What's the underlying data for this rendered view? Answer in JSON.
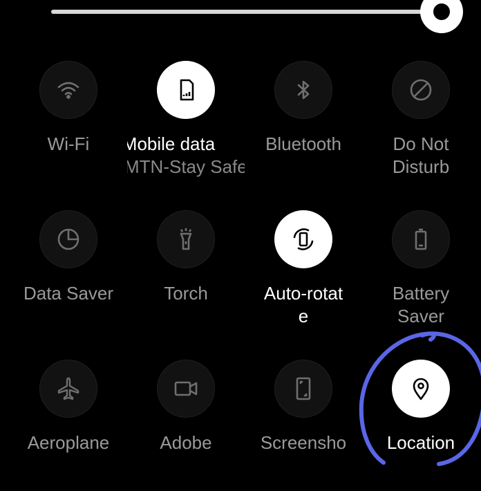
{
  "brightness": {
    "level": 0.95
  },
  "tiles": [
    {
      "label": "Wi-Fi",
      "icon": "wifi-icon",
      "on": false
    },
    {
      "label": "Mobile data",
      "sublabel": "MTN-Stay Safe",
      "icon": "sim-card-icon",
      "on": true
    },
    {
      "label": "Bluetooth",
      "icon": "bluetooth-icon",
      "on": false
    },
    {
      "label": "Do Not",
      "label2": "Disturb",
      "icon": "do-not-disturb-icon",
      "on": false
    },
    {
      "label": "Data Saver",
      "icon": "data-saver-icon",
      "on": false
    },
    {
      "label": "Torch",
      "icon": "torch-icon",
      "on": false
    },
    {
      "label": "Auto-rotat",
      "label2": "e",
      "icon": "auto-rotate-icon",
      "on": true
    },
    {
      "label": "Battery",
      "label2": "Saver",
      "icon": "battery-icon",
      "on": false
    },
    {
      "label": "Aeroplane",
      "icon": "airplane-icon",
      "on": false
    },
    {
      "label": "Adobe",
      "icon": "video-camera-icon",
      "on": false
    },
    {
      "label": "Screensho",
      "icon": "screenshot-icon",
      "on": false
    },
    {
      "label": "Location",
      "icon": "location-pin-icon",
      "on": true
    }
  ],
  "colors": {
    "background": "#000000",
    "tile_off": "#121212",
    "tile_on": "#ffffff",
    "label_off": "#9a9a9a",
    "annotation": "#5b66e6"
  }
}
